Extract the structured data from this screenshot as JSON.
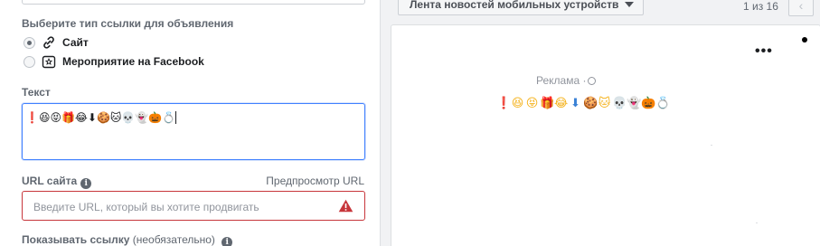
{
  "link_type": {
    "title": "Выберите тип ссылки для объявления",
    "options": [
      {
        "label": "Сайт",
        "icon": "link-icon",
        "checked": true
      },
      {
        "label": "Мероприятие на Facebook",
        "icon": "event-calendar-icon",
        "checked": false
      }
    ]
  },
  "text_field": {
    "label": "Текст",
    "value": "❗😆😝🎁😂⬇🍪🐱💀👻🎃💍"
  },
  "url_field": {
    "label": "URL сайта",
    "preview_link": "Предпросмотр URL",
    "placeholder": "Введите URL, который вы хотите продвигать",
    "error_color": "#c7363b"
  },
  "display_link": {
    "label": "Показывать ссылку",
    "optional": "(необязательно)"
  },
  "preview": {
    "placement": "Лента новостей мобильных устройств",
    "page_counter": "1 из 16",
    "more": "•••",
    "sponsored": "Реклама ·",
    "emojis": [
      "❗",
      "😆",
      "😝",
      "🎁",
      "😂",
      "⬇",
      "🍪",
      "🐱",
      "💀",
      "👻",
      "🎃",
      "💍"
    ],
    "emoji_colors": [
      "#e0245e",
      "#f5b21b",
      "#f5b21b",
      "#e86a8e",
      "#f5b21b",
      "#3b82d6",
      "#c8904a",
      "#f5b21b",
      "#d9dde2",
      "#e9ecf0",
      "#f07a1a",
      "#9ab6d6"
    ]
  },
  "colors": {
    "accent": "#4080ff",
    "error": "#c7363b",
    "label": "#606770"
  }
}
